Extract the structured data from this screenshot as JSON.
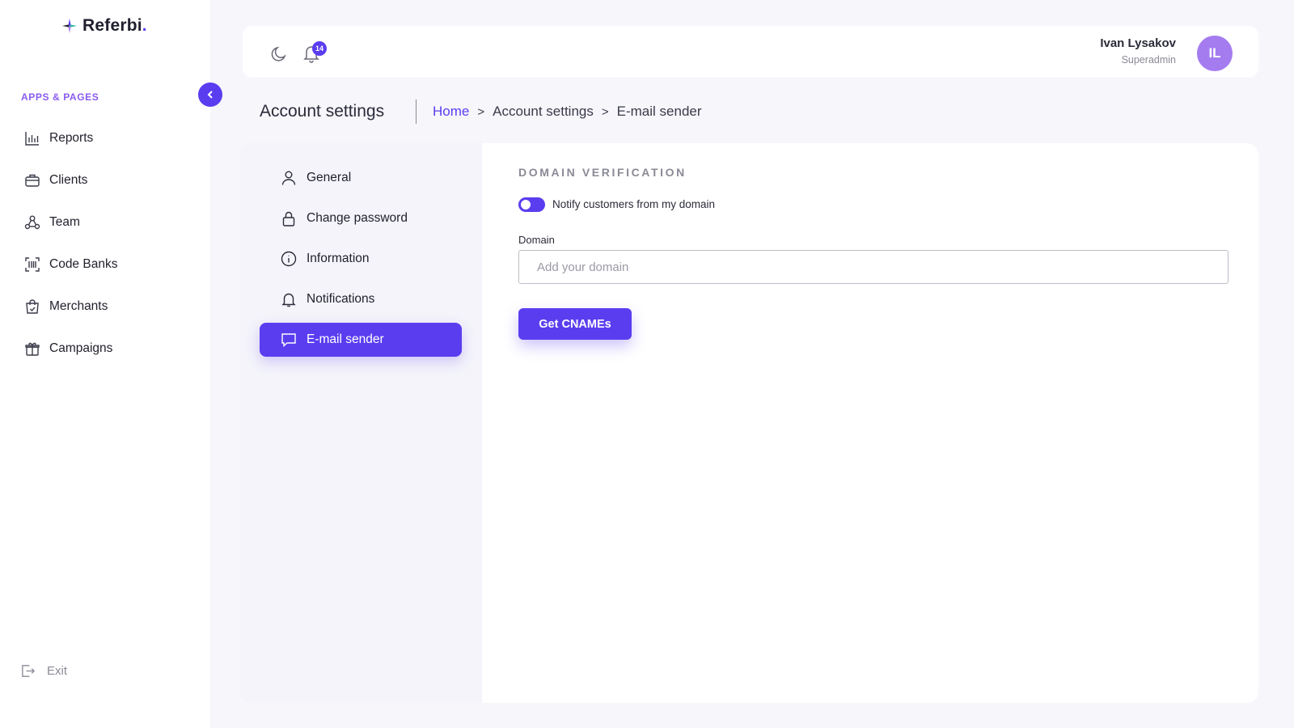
{
  "brand": {
    "name": "Referbi",
    "dot": "."
  },
  "sidebar": {
    "section_label": "APPS & PAGES",
    "items": [
      {
        "label": "Reports",
        "icon": "chart-bar-icon"
      },
      {
        "label": "Clients",
        "icon": "briefcase-icon"
      },
      {
        "label": "Team",
        "icon": "team-icon"
      },
      {
        "label": "Code Banks",
        "icon": "barcode-icon"
      },
      {
        "label": "Merchants",
        "icon": "shopping-bag-icon"
      },
      {
        "label": "Campaigns",
        "icon": "gift-icon"
      }
    ],
    "exit_label": "Exit"
  },
  "topbar": {
    "notification_count": "14",
    "user_name": "Ivan Lysakov",
    "user_role": "Superadmin",
    "avatar_initials": "IL"
  },
  "page": {
    "title": "Account settings",
    "breadcrumb": [
      "Home",
      "Account settings",
      "E-mail sender"
    ],
    "breadcrumb_sep": ">"
  },
  "settings_nav": {
    "items": [
      {
        "label": "General",
        "icon": "user-icon",
        "active": false
      },
      {
        "label": "Change password",
        "icon": "lock-icon",
        "active": false
      },
      {
        "label": "Information",
        "icon": "info-icon",
        "active": false
      },
      {
        "label": "Notifications",
        "icon": "bell-icon",
        "active": false
      },
      {
        "label": "E-mail sender",
        "icon": "message-icon",
        "active": true
      }
    ]
  },
  "domain_verification": {
    "title": "DOMAIN VERIFICATION",
    "toggle_label": "Notify customers from my domain",
    "toggle_on": true,
    "field_label": "Domain",
    "placeholder": "Add your domain",
    "value": "",
    "button_label": "Get CNAMEs"
  },
  "colors": {
    "accent": "#5b3df0",
    "avatar": "#a47cf0"
  }
}
